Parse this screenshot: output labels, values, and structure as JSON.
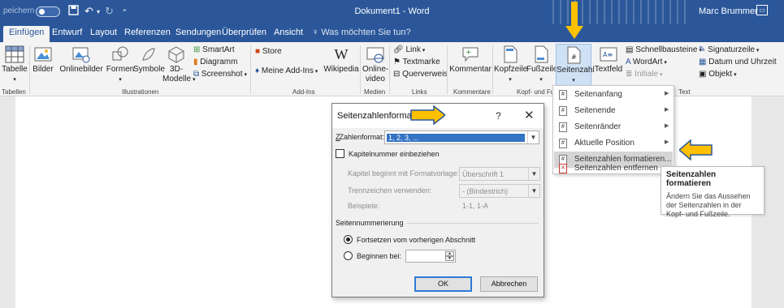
{
  "titlebar": {
    "autosave_label": "peichern",
    "document_title": "Dokument1  -  Word",
    "user_name": "Marc Brummer",
    "accent_color": "#2b579a"
  },
  "tabs": [
    "Einfügen",
    "Entwurf",
    "Layout",
    "Referenzen",
    "Sendungen",
    "Überprüfen",
    "Ansicht"
  ],
  "search": {
    "text": "Was möchten Sie tun?"
  },
  "ribbon": {
    "tabelle": "Tabelle",
    "tabellen_group": "Tabellen",
    "bilder": "Bilder",
    "onlinebilder": "Onlinebilder",
    "formen": "Formen",
    "symbole": "Symbole",
    "modelle_line1": "3D-",
    "modelle_line2": "Modelle",
    "smartart": "SmartArt",
    "diagramm": "Diagramm",
    "screenshot": "Screenshot",
    "illustrationen_group": "Illustrationen",
    "store": "Store",
    "meine_addins": "Meine Add-Ins",
    "wikipedia": "Wikipedia",
    "addins_group": "Add-Ins",
    "online_video_line1": "Online-",
    "online_video_line2": "video",
    "medien_group": "Medien",
    "link": "Link",
    "textmarke": "Textmarke",
    "querverweis": "Querverweis",
    "links_group": "Links",
    "kommentar": "Kommentar",
    "kommentare_group": "Kommentare",
    "kopfzeile": "Kopfzeile",
    "fusszeile": "Fußzeile",
    "seitenzahl": "Seitenzahl",
    "kopf_group": "Kopf- und Fuß",
    "textfeld": "Textfeld",
    "schnellbausteine": "Schnellbausteine",
    "wordart": "WordArt",
    "initiale": "Initiale",
    "signaturzeile": "Signaturzeile",
    "datum_uhrzeit": "Datum und Uhrzeit",
    "objekt": "Objekt",
    "text_group": "Text"
  },
  "menu": {
    "items": [
      {
        "label": "Seitenanfang",
        "has_submenu": true
      },
      {
        "label": "Seitenende",
        "has_submenu": true
      },
      {
        "label": "Seitenränder",
        "has_submenu": true
      },
      {
        "label": "Aktuelle Position",
        "has_submenu": true
      },
      {
        "label": "Seitenzahlen formatieren...",
        "has_submenu": false,
        "selected": true
      },
      {
        "label": "Seitenzahlen entfernen",
        "has_submenu": false
      }
    ]
  },
  "tooltip": {
    "title": "Seitenzahlen formatieren",
    "description": "Ändern Sie das Aussehen der Seitenzahlen in der Kopf- und Fußzeile."
  },
  "dialog": {
    "title": "Seitenzahlenformat",
    "help": "?",
    "close": "✕",
    "zahlenformat_label": "Zahlenformat:",
    "zahlenformat_value": "1, 2, 3, ...",
    "kapitelnummer_label": "Kapitelnummer einbeziehen",
    "kapitel_beginnt_label": "Kapitel beginnt mit Formatvorlage:",
    "kapitel_beginnt_value": "Überschrift 1",
    "trennzeichen_label": "Trennzeichen verwenden:",
    "trennzeichen_value": "-    (Bindestrich)",
    "beispiele_label": "Beispiele:",
    "beispiele_value": "1-1, 1-A",
    "section_label": "Seitennummerierung",
    "fortsetzen_label": "Fortsetzen vom vorherigen Abschnitt",
    "beginnen_label": "Beginnen bei:",
    "ok_label": "OK",
    "abbrechen_label": "Abbrechen"
  },
  "highlight_color": "#ffc000"
}
